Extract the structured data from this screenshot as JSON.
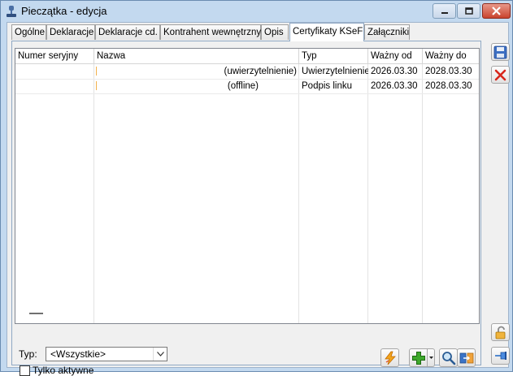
{
  "window": {
    "title": "Pieczątka - edycja"
  },
  "tabs": [
    {
      "label": "Ogólne"
    },
    {
      "label": "Deklaracje"
    },
    {
      "label": "Deklaracje cd."
    },
    {
      "label": "Kontrahent wewnętrzny"
    },
    {
      "label": "Opis"
    },
    {
      "label": "Certyfikaty KSeF"
    },
    {
      "label": "Załączniki"
    }
  ],
  "active_tab": "Certyfikaty KSeF",
  "grid": {
    "columns": [
      "Numer seryjny",
      "Nazwa",
      "Typ",
      "Ważny od",
      "Ważny do"
    ],
    "rows": [
      {
        "numer": "",
        "nazwa": "(uwierzytelnienie)",
        "typ": "Uwierzytelnienie",
        "od": "2026.03.30",
        "do": "2028.03.30"
      },
      {
        "numer": "",
        "nazwa": "(offline)",
        "typ": "Podpis linku",
        "od": "2026.03.30",
        "do": "2028.03.30"
      }
    ]
  },
  "filter": {
    "typ_label": "Typ:",
    "typ_value": "<Wszystkie>",
    "only_active_label": "Tylko aktywne",
    "only_active_checked": false
  },
  "icons": {
    "save": "save-icon",
    "delete": "delete-icon",
    "lock": "lock-icon",
    "pin": "pin-icon",
    "generate": "lightning-icon",
    "add": "add-icon",
    "search": "search-icon",
    "import": "import-icon"
  }
}
